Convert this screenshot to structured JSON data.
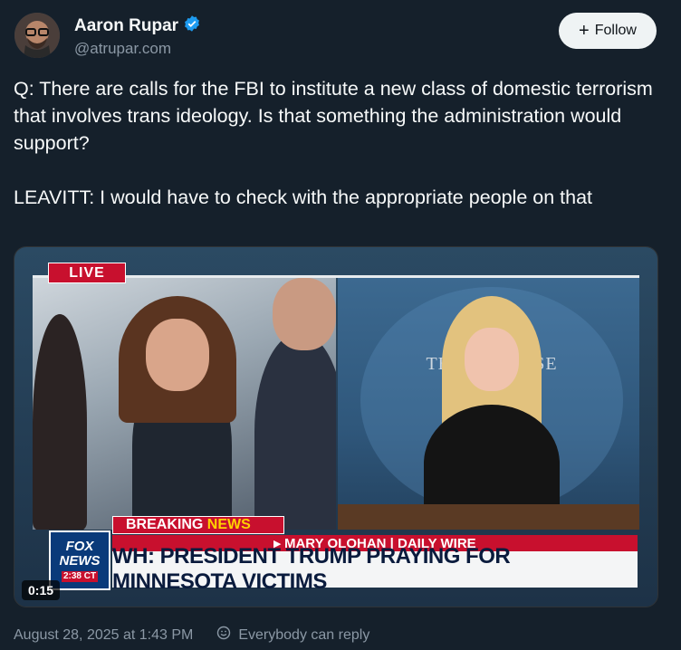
{
  "author": {
    "name": "Aaron Rupar",
    "handle": "@atrupar.com",
    "verified_icon": "verified-badge-icon",
    "avatar_icon": "avatar"
  },
  "follow_button": {
    "label": "Follow",
    "icon": "plus-icon"
  },
  "tweet": {
    "paragraph1": "Q: There are calls for the FBI to institute a new class of domestic terrorism that involves trans ideology. Is that something the administration would support?",
    "paragraph2": "LEAVITT: I would have to check with the appropriate people on that"
  },
  "video": {
    "live_label": "LIVE",
    "breaking_label_1": "BREAKING",
    "breaking_label_2": "NEWS",
    "byline": "▸ MARY OLOHAN | DAILY WIRE",
    "headline": "WH: PRESIDENT TRUMP PRAYING FOR MINNESOTA VICTIMS",
    "network_logo": "FOX NEWS",
    "network_clock": "2:38 CT",
    "backdrop_text": "THE WH     OUSE",
    "duration": "0:15"
  },
  "footer": {
    "timestamp": "August 28, 2025 at 1:43 PM",
    "reply_setting": "Everybody can reply",
    "reply_icon": "globe-icon"
  },
  "colors": {
    "background": "#15202b",
    "text_primary": "#f7f9f9",
    "text_secondary": "#8b98a5",
    "verified_blue": "#1d9bf0",
    "fox_red": "#c8102e"
  }
}
